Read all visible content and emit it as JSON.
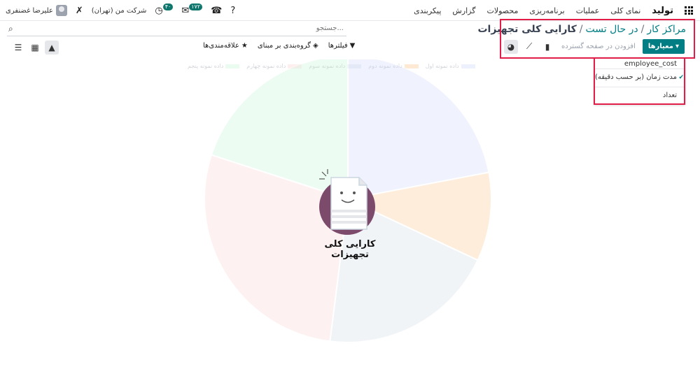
{
  "navbar": {
    "brand": "تولید",
    "menu": [
      "نمای کلی",
      "عملیات",
      "برنامه‌ریزی",
      "محصولات",
      "گزارش",
      "پیکربندی"
    ],
    "company": "شرکت من (تهران)",
    "user_name": "علیرضا غضنفری",
    "activities_badge": "۴۰",
    "messages_badge": "۱۷۲"
  },
  "breadcrumb": {
    "items": [
      "مراکز کار",
      "در حال تست",
      "کارایی کلی تجهیزات"
    ],
    "separator": "/"
  },
  "search": {
    "placeholder": "جستجو..."
  },
  "filters": {
    "filters_label": "فیلترها",
    "groupby_label": "گروه‌بندی بر مبنای",
    "favorites_label": "علاقه‌مندی‌ها"
  },
  "graph_toolbar": {
    "measures_label": "معیارها",
    "insert_label": "افزودن در صفحه گسترده"
  },
  "measures_dropdown": {
    "items": [
      {
        "label": "employee_cost",
        "checked": false
      },
      {
        "label": "مدت زمان (بر حسب دقیقه)",
        "checked": true
      },
      {
        "label": "تعداد",
        "checked": false
      }
    ]
  },
  "chart_data": {
    "type": "pie",
    "categories": [
      "داده نمونه اول",
      "داده نمونه دوم",
      "داده نمونه سوم",
      "داده نمونه چهارم",
      "داده نمونه پنجم"
    ],
    "values": [
      22,
      10,
      20,
      28,
      20
    ],
    "colors": [
      "#c7d2fe",
      "#fdba74",
      "#cbd5e1",
      "#fecaca",
      "#bbf7d0"
    ]
  },
  "helper": {
    "title": "کارایی کلی تجهیزات"
  },
  "colors": {
    "accent": "#017e84",
    "highlight": "#e11d48"
  }
}
